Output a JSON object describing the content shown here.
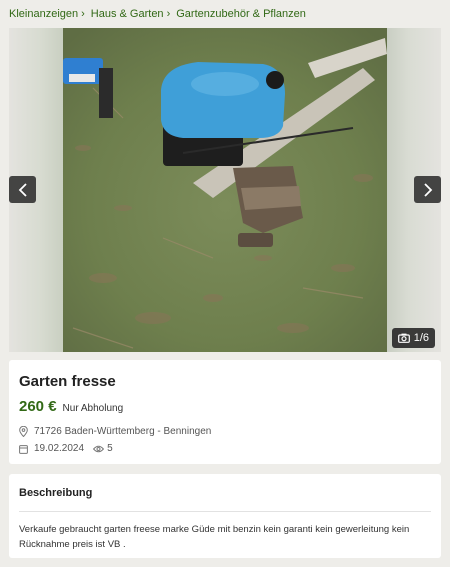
{
  "breadcrumb": {
    "items": [
      "Kleinanzeigen",
      "Haus & Garten",
      "Gartenzubehör & Pflanzen"
    ]
  },
  "gallery": {
    "counter": "1/6",
    "icons": {
      "prev": "chevron-left-icon",
      "next": "chevron-right-icon",
      "camera": "camera-icon"
    }
  },
  "listing": {
    "title": "Garten fresse",
    "price": "260 €",
    "price_note": "Nur Abholung",
    "location": "71726 Baden-Württemberg - Benningen",
    "date": "19.02.2024",
    "views": "5"
  },
  "description": {
    "heading": "Beschreibung",
    "text": "Verkaufe gebraucht garten freese marke Güde mit benzin kein garanti kein gewerleitung kein Rücknahme preis ist VB ."
  },
  "colors": {
    "accent": "#326916",
    "background": "#eeede9",
    "card": "#ffffff"
  }
}
